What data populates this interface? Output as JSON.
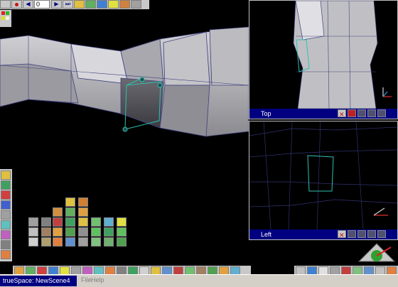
{
  "toolbar": {
    "frame_value": "0"
  },
  "viewports": {
    "top": {
      "label": "Top"
    },
    "left": {
      "label": "Left"
    }
  },
  "statusbar": {
    "app_title": "trueSpace: NewScene4",
    "menu_file": "File",
    "menu_help": "Help"
  },
  "colors": {
    "background": "#000000",
    "titlebar": "#000080",
    "panel": "#c8c8c8",
    "mesh": "#b8b8bc",
    "wire": "#4040a0",
    "selection": "#30c0b0"
  },
  "icons": [
    "record-icon",
    "rewind-icon",
    "play-icon",
    "forward-icon",
    "paint-icon",
    "close-icon",
    "axis-icon",
    "sphere-icon",
    "cube-icon",
    "torus-icon"
  ]
}
